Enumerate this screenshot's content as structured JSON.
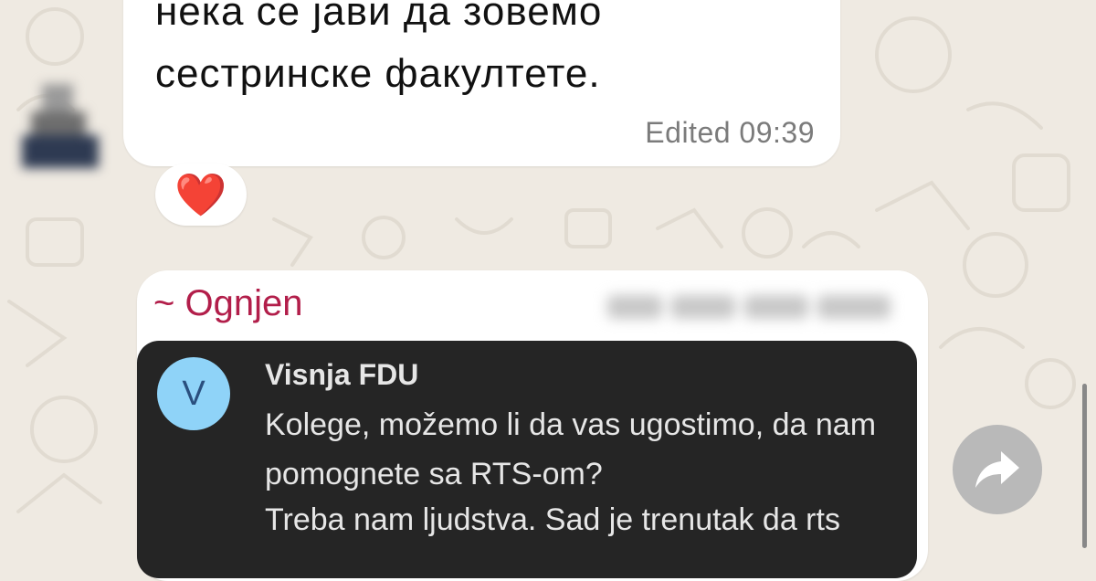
{
  "message_top": {
    "lines": [
      "нека се јави да зовемо",
      "сестринске факултете."
    ],
    "edited_label": "Edited",
    "time": "09:39",
    "reaction": "❤️"
  },
  "forwarded_message": {
    "sender": "~ Ognjen",
    "card": {
      "avatar_initial": "V",
      "name": "Visnja FDU",
      "lines": [
        "Kolege, možemo li da vas ugostimo, da nam",
        "pomognete sa RTS-om?",
        "Treba nam ljudstva. Sad je trenutak da rts"
      ]
    }
  },
  "colors": {
    "sender": "#b21e4a",
    "chat_background": "#efeae2",
    "card_background": "#252525",
    "card_avatar": "#8fd3f8"
  },
  "icons": {
    "share": "share-forward-icon",
    "reaction": "heart-icon"
  }
}
